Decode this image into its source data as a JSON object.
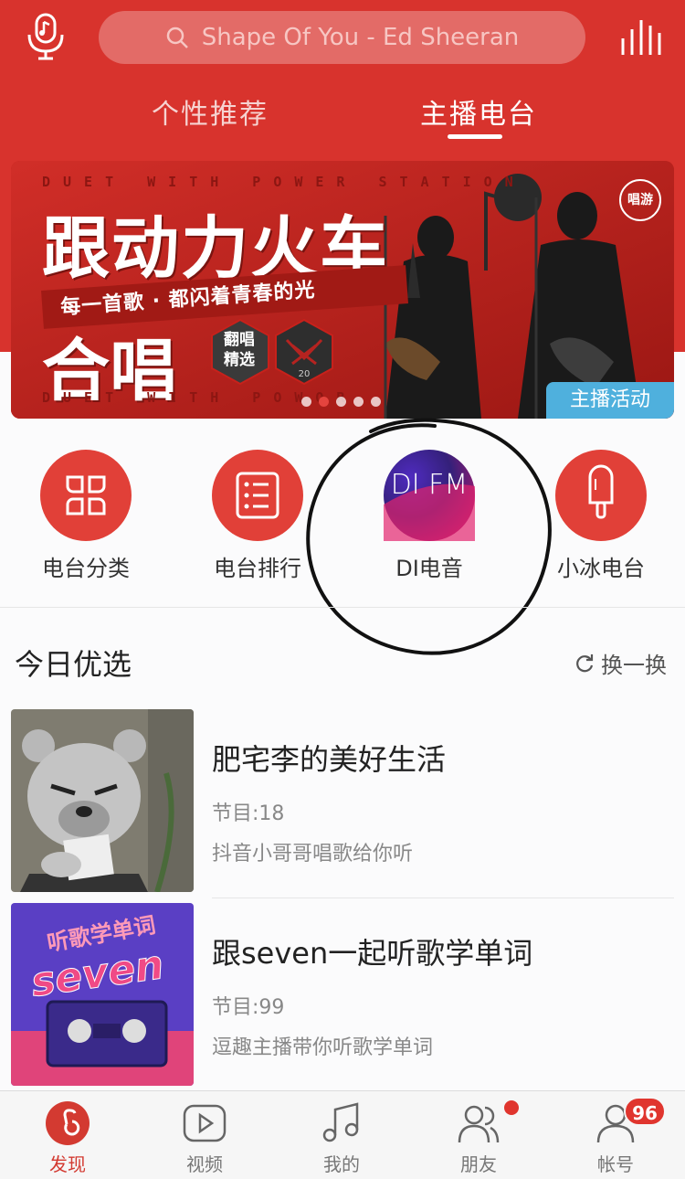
{
  "header": {
    "search_placeholder": "Shape Of You - Ed Sheeran",
    "tabs": [
      {
        "label": "个性推荐",
        "active": false
      },
      {
        "label": "主播电台",
        "active": true
      }
    ],
    "brand_color": "#d8332d"
  },
  "banner": {
    "english_line": "DUET WITH POWER STATION",
    "english_line_bottom": "DUET WITH POWOR",
    "title": "跟动力火车",
    "slogan": "每一首歌 · 都闪着青春的光",
    "subtitle": "合唱",
    "badge_text": "翻唱精选",
    "badge_number": "20",
    "logo_text": "唱游",
    "tag": "主播活动",
    "slide_count": 5,
    "active_slide": 2
  },
  "quick_menu": [
    {
      "label": "电台分类",
      "icon": "category-icon"
    },
    {
      "label": "电台排行",
      "icon": "ranking-list-icon"
    },
    {
      "label": "DI电音",
      "icon": "difm-logo-icon",
      "logo_text": "DI FM"
    },
    {
      "label": "小冰电台",
      "icon": "popsicle-icon"
    }
  ],
  "today": {
    "title": "今日优选",
    "refresh_label": "换一换",
    "items": [
      {
        "title": "肥宅李的美好生活",
        "episodes": "节目:18",
        "desc": "抖音小哥哥唱歌给你听"
      },
      {
        "title": "跟seven一起听歌学单词",
        "episodes": "节目:99",
        "desc": "逗趣主播带你听歌学单词",
        "cover_text_top": "听歌学单词",
        "cover_text_main": "seven"
      }
    ]
  },
  "tabbar": {
    "items": [
      {
        "label": "发现",
        "icon": "discover-icon",
        "active": true
      },
      {
        "label": "视频",
        "icon": "video-icon",
        "active": false
      },
      {
        "label": "我的",
        "icon": "music-note-icon",
        "active": false
      },
      {
        "label": "朋友",
        "icon": "friends-icon",
        "active": false
      },
      {
        "label": "帐号",
        "icon": "account-icon",
        "active": false
      }
    ],
    "account_badge": "96"
  }
}
